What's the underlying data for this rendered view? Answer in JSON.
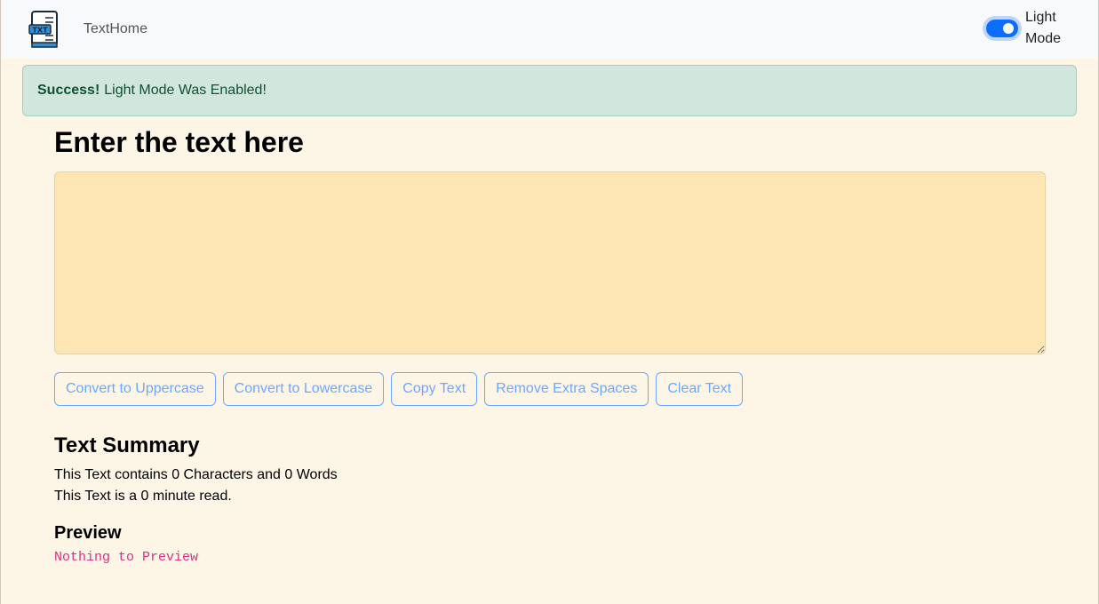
{
  "navbar": {
    "brand": "TextHome",
    "logo_icon": "txt-file-icon",
    "toggle_label": "Light Mode",
    "toggle_on": true
  },
  "alert": {
    "title": "Success!",
    "message": "Light Mode Was Enabled!"
  },
  "main": {
    "heading": "Enter the text here",
    "textarea_value": "",
    "buttons": [
      {
        "label": "Convert to Uppercase"
      },
      {
        "label": "Convert to Lowercase"
      },
      {
        "label": "Copy Text"
      },
      {
        "label": "Remove Extra Spaces"
      },
      {
        "label": "Clear Text"
      }
    ]
  },
  "summary": {
    "heading": "Text Summary",
    "counts": "This Text contains 0 Characters and 0 Words",
    "read_time": "This Text is a 0 minute read."
  },
  "preview": {
    "heading": "Preview",
    "text": "Nothing to Preview"
  },
  "colors": {
    "accent": "#0d6efd",
    "button_outline": "#6ea8fe",
    "page_background": "#fdf5e6",
    "textarea_background": "#fde6b3",
    "alert_background": "#d1e7dd",
    "preview_text": "#d63384"
  }
}
